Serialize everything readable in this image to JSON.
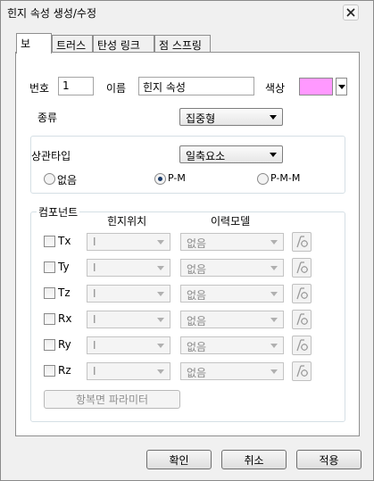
{
  "window": {
    "title": "힌지 속성 생성/수정",
    "close_icon": "close-icon"
  },
  "tabs": [
    {
      "label": "보",
      "active": true
    },
    {
      "label": "트러스",
      "active": false
    },
    {
      "label": "탄성 링크",
      "active": false
    },
    {
      "label": "점 스프링",
      "active": false
    }
  ],
  "form": {
    "number_label": "번호",
    "number_value": "1",
    "name_label": "이름",
    "name_value": "힌지 속성",
    "color_label": "색상",
    "color_value": "#ff99ff",
    "type_label": "종류",
    "type_value": "집중형"
  },
  "correlation": {
    "title": "상관타입",
    "type_value": "일축요소",
    "options": [
      {
        "label": "없음",
        "checked": false
      },
      {
        "label": "P-M",
        "checked": true
      },
      {
        "label": "P-M-M",
        "checked": false
      }
    ]
  },
  "components": {
    "title": "컴포넌트",
    "col_hinge_position": "힌지위치",
    "col_hysteresis_model": "이력모델",
    "rows": [
      {
        "label": "Tx",
        "position": "I",
        "model": "없음",
        "checked": false
      },
      {
        "label": "Ty",
        "position": "I",
        "model": "없음",
        "checked": false
      },
      {
        "label": "Tz",
        "position": "I",
        "model": "없음",
        "checked": false
      },
      {
        "label": "Rx",
        "position": "I",
        "model": "없음",
        "checked": false
      },
      {
        "label": "Ry",
        "position": "I",
        "model": "없음",
        "checked": false
      },
      {
        "label": "Rz",
        "position": "I",
        "model": "없음",
        "checked": false
      }
    ],
    "yield_params_label": "항복면 파라미터"
  },
  "buttons": {
    "ok": "확인",
    "cancel": "취소",
    "apply": "적용"
  }
}
